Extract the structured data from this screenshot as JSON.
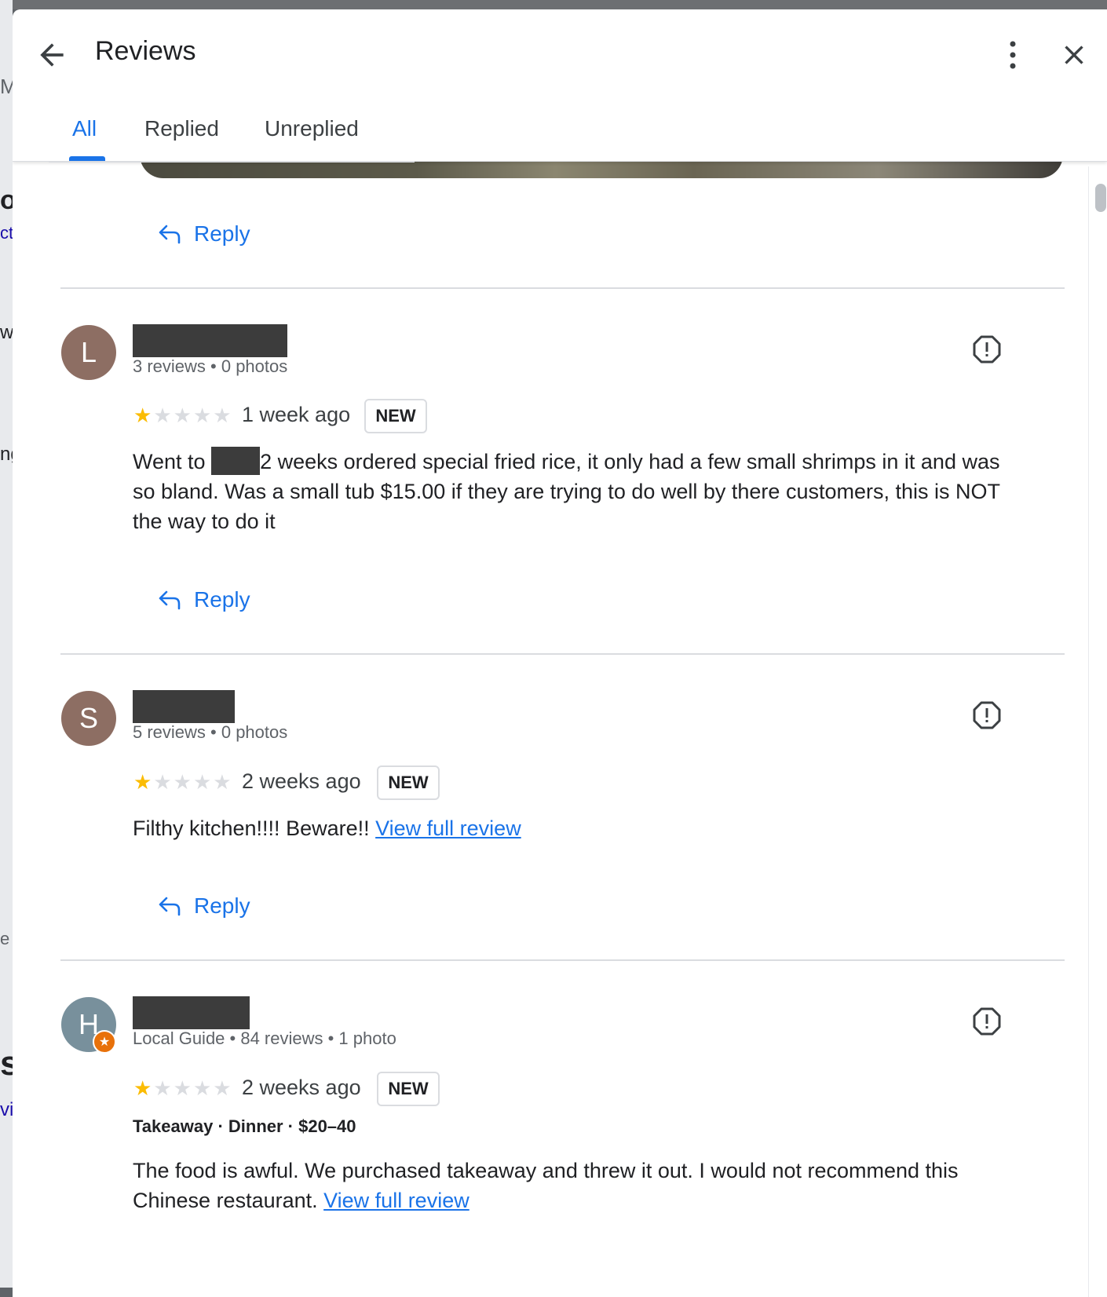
{
  "header": {
    "title": "Reviews",
    "tabs": [
      {
        "label": "All",
        "active": true
      },
      {
        "label": "Replied",
        "active": false
      },
      {
        "label": "Unreplied",
        "active": false
      }
    ]
  },
  "colors": {
    "accent": "#1a73e8",
    "star": "#fbbc04",
    "guide": "#e8710a"
  },
  "reply_label": "Reply",
  "reviews": [
    {
      "avatar_letter": "L",
      "avatar_color": "#8d6e63",
      "meta": "3 reviews • 0 photos",
      "rating": 1,
      "time_ago": "1 week ago",
      "badge": "NEW",
      "text_before": "Went to ",
      "text_after": "2 weeks ordered special fried rice, it only had a few small shrimps in it and was so bland. Was a small tub $15.00 if they are trying to do well by there customers, this is NOT the way to do it"
    },
    {
      "avatar_letter": "S",
      "avatar_color": "#8d6e63",
      "meta": "5 reviews • 0 photos",
      "rating": 1,
      "time_ago": "2 weeks ago",
      "badge": "NEW",
      "text": "Filthy kitchen!!!! Beware!! ",
      "link": "View full review"
    },
    {
      "avatar_letter": "H",
      "avatar_color": "#78909c",
      "local_guide": true,
      "meta": "Local Guide • 84 reviews • 1 photo",
      "rating": 1,
      "time_ago": "2 weeks ago",
      "badge": "NEW",
      "tags": "Takeaway · Dinner · $20–40",
      "text": "The food is awful. We purchased takeaway and threw it out. I would not recommend this Chinese restaurant. ",
      "link": "View full review"
    }
  ],
  "background_fragments": [
    "M",
    "or",
    "ct",
    "ws",
    "ng",
    "e",
    "s",
    "vie"
  ]
}
